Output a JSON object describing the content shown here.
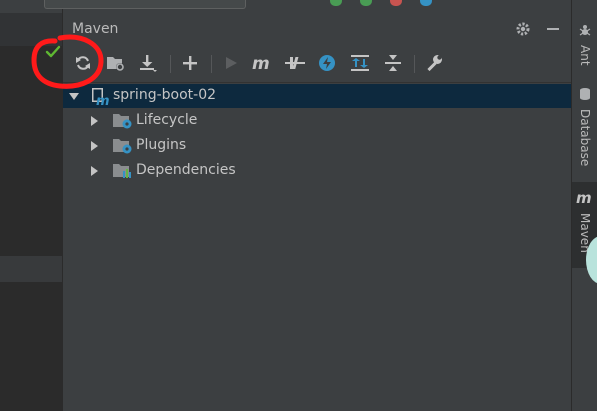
{
  "panel": {
    "title": "Maven"
  },
  "header_buttons": [
    {
      "name": "settings-gear-icon"
    },
    {
      "name": "hide-minus-icon"
    }
  ],
  "toolbar": {
    "items": [
      {
        "name": "reload-all-maven-projects-icon"
      },
      {
        "name": "generate-sources-icon"
      },
      {
        "name": "download-sources-icon"
      },
      {
        "name": "add-maven-project-icon"
      },
      {
        "name": "run-maven-build-icon"
      },
      {
        "name": "execute-maven-goal-icon"
      },
      {
        "name": "toggle-offline-mode-icon"
      },
      {
        "name": "toggle-skip-tests-icon"
      },
      {
        "name": "show-dependencies-icon"
      },
      {
        "name": "collapse-all-icon"
      },
      {
        "name": "maven-settings-wrench-icon"
      }
    ]
  },
  "tree": {
    "root": {
      "label": "spring-boot-02",
      "expanded": true,
      "selected": true
    },
    "children": [
      {
        "label": "Lifecycle",
        "expanded": false
      },
      {
        "label": "Plugins",
        "expanded": false
      },
      {
        "label": "Dependencies",
        "expanded": false
      }
    ]
  },
  "right_toolbar": {
    "tabs": [
      {
        "label": "Ant",
        "active": false
      },
      {
        "label": "Database",
        "active": false
      },
      {
        "label": "Maven",
        "active": true
      }
    ]
  },
  "colors": {
    "background": "#3c3f41",
    "selection": "#0d293e",
    "icon_blue": "#3592c4",
    "annotation_red": "#ff1a1a",
    "check_green": "#5fb832"
  }
}
